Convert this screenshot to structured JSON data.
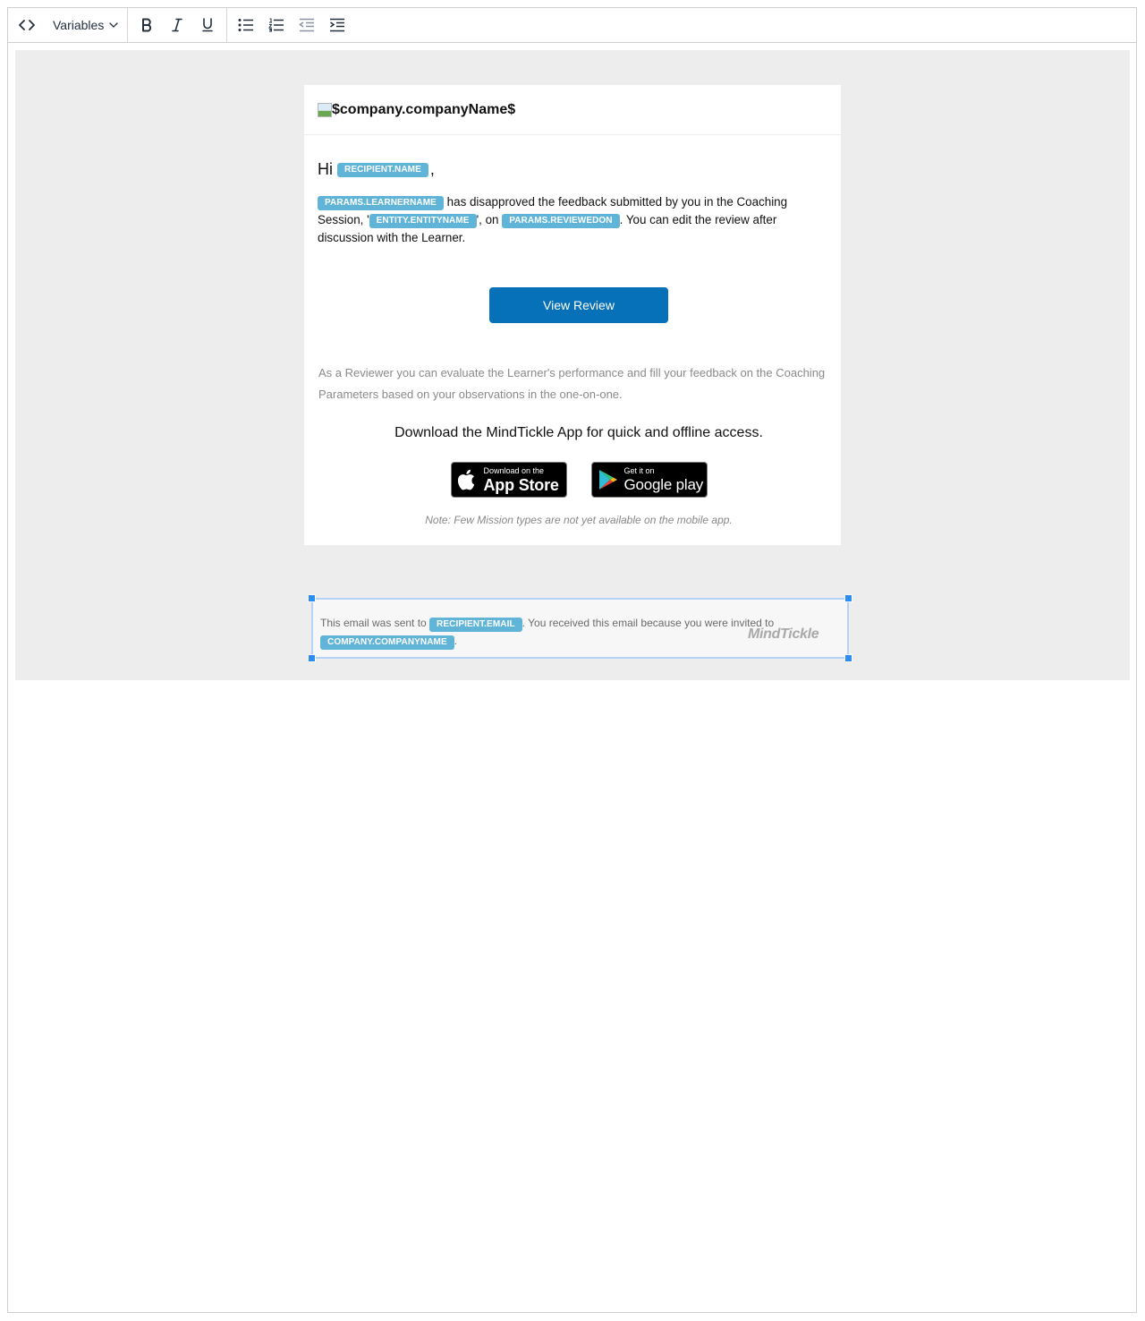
{
  "toolbar": {
    "variables_label": "Variables",
    "buttons": [
      "source-code",
      "bold",
      "italic",
      "underline",
      "bullet-list",
      "numbered-list",
      "outdent",
      "indent"
    ]
  },
  "email": {
    "header_alt_text": "$company.companyName$",
    "greeting": {
      "prefix": "Hi",
      "tag": "RECIPIENT.NAME",
      "suffix": ","
    },
    "paragraph": {
      "tag_learner": "PARAMS.LEARNERNAME",
      "text_1": " has disapproved the feedback submitted by you in the Coaching Session, '",
      "tag_entity": "ENTITY.ENTITYNAME",
      "text_2": "', on ",
      "tag_reviewed": "PARAMS.REVIEWEDON",
      "text_3": ". You can edit the review after discussion with the Learner."
    },
    "cta_label": "View Review",
    "reviewer_note": "As a Reviewer you can evaluate the Learner's performance and fill your feedback on the Coaching Parameters based on your observations in the one-on-one.",
    "download_heading": "Download the MindTickle App for quick and offline access.",
    "app_store": {
      "small": "Download on the",
      "big": "App Store"
    },
    "google_play": {
      "small": "Get it on",
      "big": "Google play"
    },
    "mobile_note": "Note: Few Mission types are not yet available on the mobile app."
  },
  "footer": {
    "text_1": "This email was sent to ",
    "tag_email": "RECIPIENT.EMAIL",
    "text_2": ". You received this email because you were invited to ",
    "tag_company": "COMPANY.COMPANYNAME",
    "text_3": "."
  },
  "brand_logo": "MindTickle",
  "colors": {
    "accent": "#0670b8",
    "tag": "#5fb4d8",
    "selection": "#2d8cf0",
    "canvas": "#ededed"
  }
}
